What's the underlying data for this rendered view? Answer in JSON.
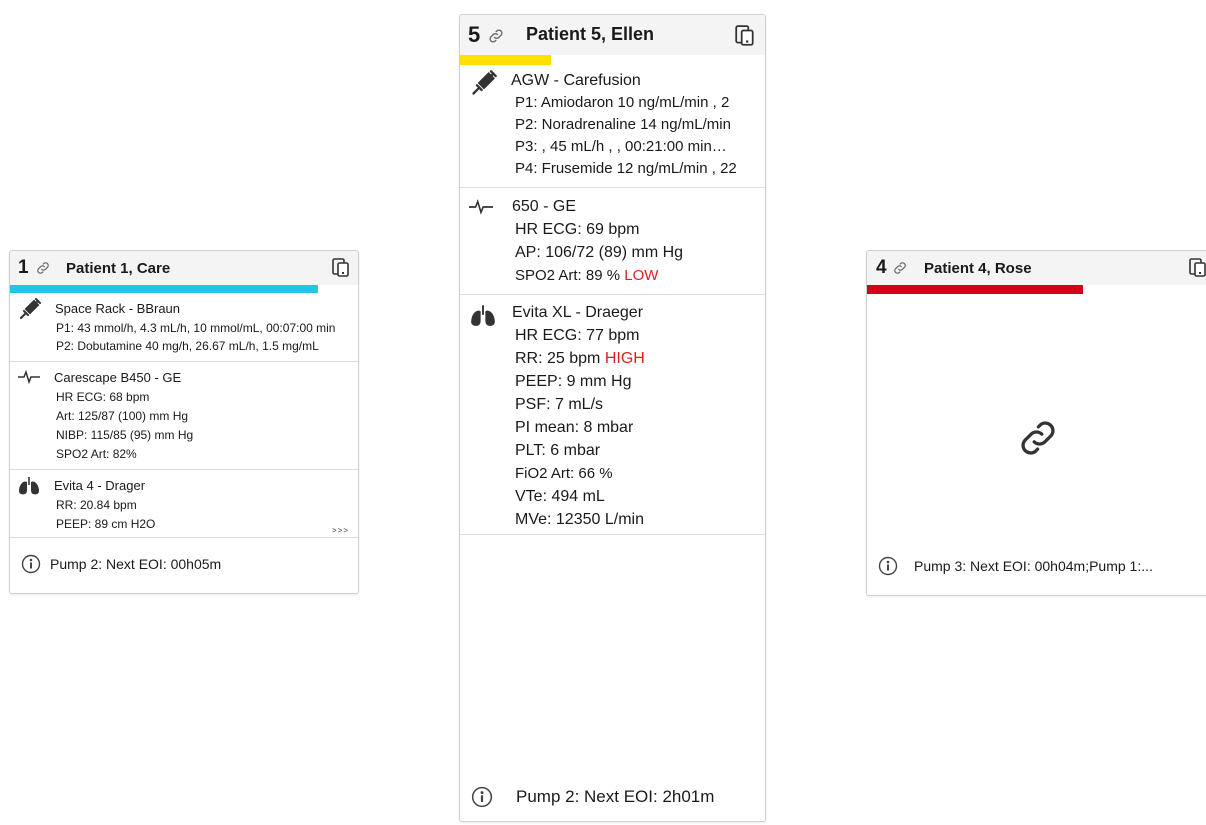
{
  "colors": {
    "patient1_bar": "#1ec8e0",
    "patient5_bar": "#ffe000",
    "patient4_bar": "#d0021b",
    "alert": "#e02020"
  },
  "icons": {
    "link": "link-icon",
    "device": "device-icon",
    "syringe": "syringe-icon",
    "ecg": "ecg-icon",
    "lungs": "lungs-icon",
    "info": "info-icon"
  },
  "patient1": {
    "number": "1",
    "title": "Patient 1, Care",
    "bar_fill": 0.88,
    "pump": {
      "device": "Space Rack - BBraun",
      "lines": [
        "P1: 43 mmol/h, 4.3 mL/h, 10 mmol/mL, 00:07:00 min",
        "P2: Dobutamine 40 mg/h, 26.67 mL/h, 1.5 mg/mL"
      ]
    },
    "monitor": {
      "device": "Carescape B450 - GE",
      "lines": [
        "HR ECG: 68 bpm",
        "Art: 125/87 (100) mm Hg",
        "NIBP: 115/85 (95) mm Hg",
        "SPO2 Art: 82%"
      ]
    },
    "vent": {
      "device": "Evita 4 - Drager",
      "lines": [
        "RR: 20.84 bpm",
        "PEEP:  89 cm H2O"
      ],
      "more": ">>>"
    },
    "footer": "Pump 2: Next EOI: 00h05m"
  },
  "patient5": {
    "number": "5",
    "title": "Patient 5, Ellen",
    "bar_fill": 0.3,
    "pump": {
      "device": "AGW - Carefusion",
      "lines": [
        "P1: Amiodaron 10 ng/mL/min , 2",
        "P2: Noradrenaline 14 ng/mL/min",
        "P3:  , 45 mL/h ,  , 00:21:00 min…",
        "P4: Frusemide 12 ng/mL/min , 22"
      ]
    },
    "monitor": {
      "device": "650 - GE",
      "hr": "HR ECG: 69 bpm",
      "ap": "AP: 106/72 (89) mm Hg",
      "spo2": "SPO2 Art: 89 %",
      "spo2_flag": "LOW"
    },
    "vent": {
      "device": "Evita XL - Draeger",
      "hr": "HR ECG: 77 bpm",
      "rr": "RR: 25 bpm",
      "rr_flag": "HIGH",
      "lines": [
        "PEEP:  9 mm Hg",
        "PSF: 7 mL/s",
        "PI mean: 8 mbar",
        "PLT: 6 mbar",
        "FiO2 Art: 66 %",
        "VTe: 494 mL",
        "MVe: 12350 L/min"
      ]
    },
    "footer": "Pump 2: Next EOI: 2h01m"
  },
  "patient4": {
    "number": "4",
    "title": "Patient 4, Rose",
    "bar_fill": 0.63,
    "footer": "Pump 3: Next EOI: 00h04m;Pump 1:..."
  }
}
